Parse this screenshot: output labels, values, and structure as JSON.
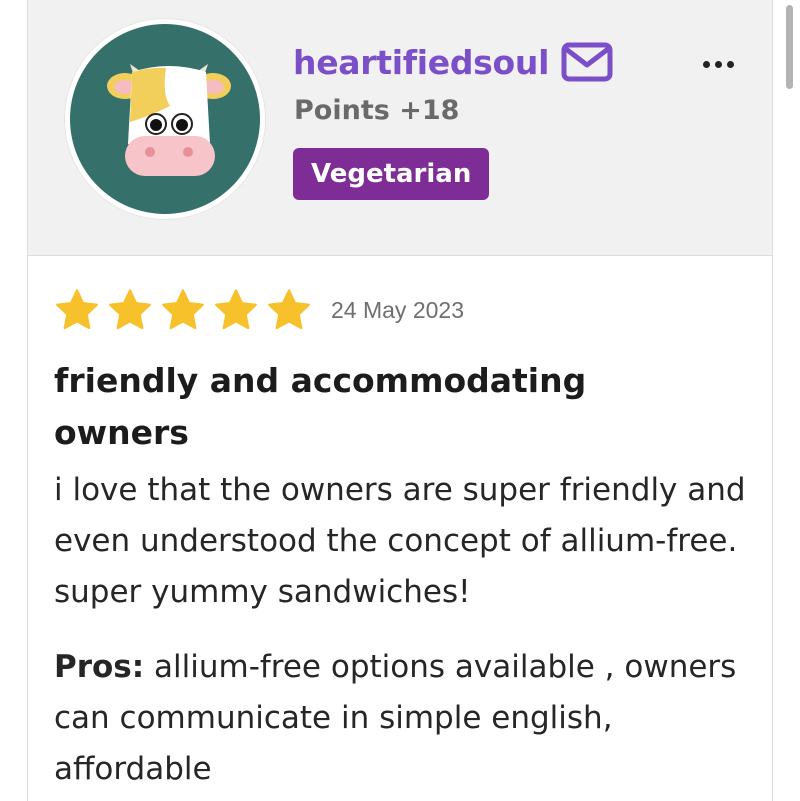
{
  "profile": {
    "username": "heartifiedsoul",
    "points": "Points +18",
    "badge": "Vegetarian",
    "avatar_icon": "cow-avatar-icon",
    "message_icon": "mail-icon",
    "menu_icon": "more-horizontal-icon"
  },
  "review": {
    "rating": 5,
    "max_rating": 5,
    "date": "24 May 2023",
    "title": "friendly and accommodating owners",
    "body": "i love that the owners are super friendly and even understood the concept of allium-free. super yummy sandwiches!",
    "pros_label": "Pros:",
    "pros_text": " allium-free options available , owners can communicate in simple english, affordable"
  },
  "colors": {
    "username": "#7b4fc8",
    "badge_bg": "#7e2c96",
    "avatar_bg": "#35706a",
    "star": "#f7c12b",
    "header_bg": "#f1f1f1"
  }
}
